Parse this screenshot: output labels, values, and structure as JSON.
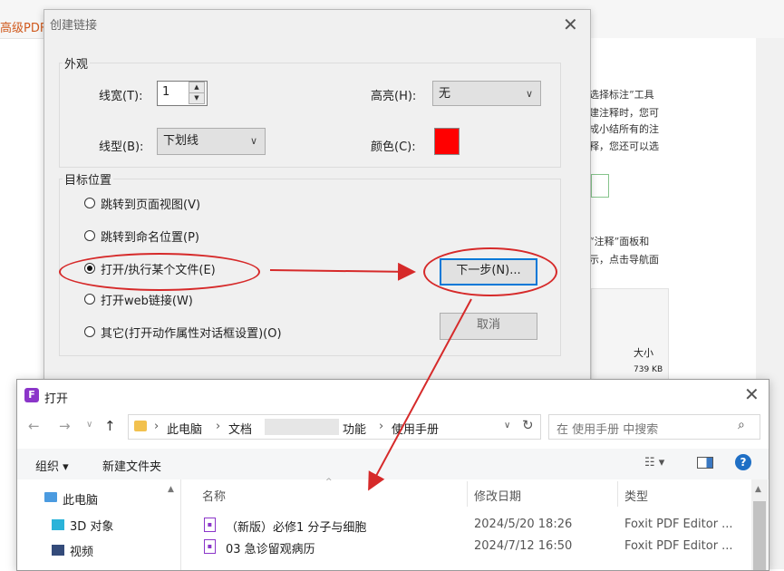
{
  "background_app": {
    "tab_label": "高级PDF编",
    "text_lines": [
      "选择标注”工具",
      "建注释时，您可",
      "成小结所有的注",
      "释，您还可以选",
      "“注释”面板和",
      "示，点击导航面"
    ],
    "panel_size_label": "大小",
    "panel_size_value": "739 KB"
  },
  "link_dialog": {
    "title": "创建链接",
    "appearance_group": "外观",
    "line_width_label": "线宽(T):",
    "line_width_value": "1",
    "highlight_label": "高亮(H):",
    "highlight_value": "无",
    "line_style_label": "线型(B):",
    "line_style_value": "下划线",
    "color_label": "颜色(C):",
    "color_value": "#ff0000",
    "target_group": "目标位置",
    "options": [
      {
        "label": "跳转到页面视图(V)",
        "selected": false
      },
      {
        "label": "跳转到命名位置(P)",
        "selected": false
      },
      {
        "label": "打开/执行某个文件(E)",
        "selected": true
      },
      {
        "label": "打开web链接(W)",
        "selected": false
      },
      {
        "label": "其它(打开动作属性对话框设置)(O)",
        "selected": false
      }
    ],
    "next_button": "下一步(N)...",
    "cancel_button": "取消"
  },
  "open_dialog": {
    "title": "打开",
    "breadcrumb": [
      "此电脑",
      "文档",
      "功能",
      "使用手册"
    ],
    "search_placeholder": "在 使用手册 中搜索",
    "organize": "组织",
    "new_folder": "新建文件夹",
    "nav_items": [
      "此电脑",
      "3D 对象",
      "视频"
    ],
    "columns": {
      "name": "名称",
      "modified": "修改日期",
      "type": "类型"
    },
    "files": [
      {
        "name": "（新版）必修1 分子与细胞",
        "modified": "2024/5/20 18:26",
        "type": "Foxit PDF Editor ..."
      },
      {
        "name": "03 急诊留观病历",
        "modified": "2024/7/12 16:50",
        "type": "Foxit PDF Editor ..."
      }
    ]
  },
  "colors": {
    "annotation": "#d62a2a",
    "accent": "#0078d7",
    "foxit": "#8b35c9"
  }
}
